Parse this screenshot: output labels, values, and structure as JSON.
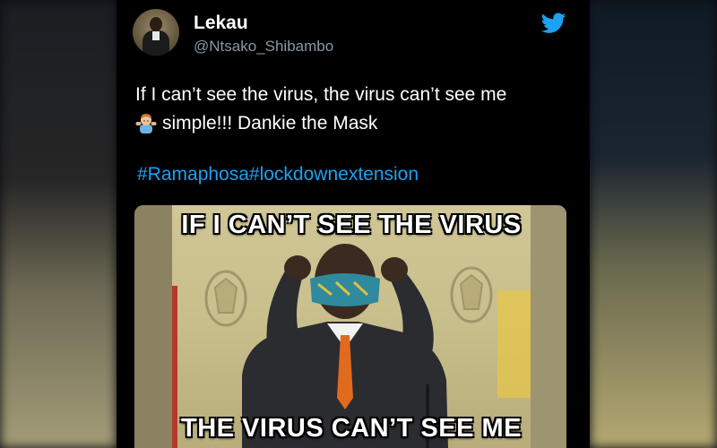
{
  "tweet": {
    "author_name": "Lekau",
    "author_handle": "@Ntsako_Shibambo",
    "text_line1": "If I can’t see the virus, the virus can’t see me",
    "text_line2": "simple!!! Dankie the Mask",
    "emoji": "man-shrugging-emoji",
    "hashtags": "#Ramaphosa#lockdownextension",
    "brand_icon": "twitter-bird-icon",
    "colors": {
      "background": "#000000",
      "text": "#ffffff",
      "handle": "#8899a6",
      "link": "#1da1f2"
    }
  },
  "media": {
    "caption_top": "IF I CAN’T SEE THE VIRUS",
    "caption_bottom": "THE VIRUS CAN’T SEE ME"
  }
}
